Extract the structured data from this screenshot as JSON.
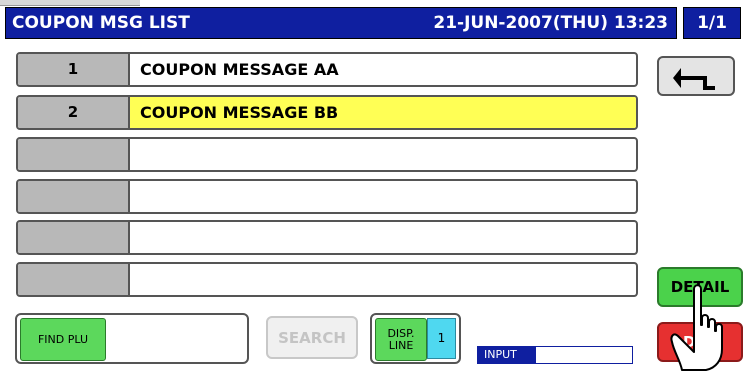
{
  "header": {
    "title": "COUPON MSG LIST",
    "datetime": "21-JUN-2007(THU) 13:23",
    "page": "1/1"
  },
  "rows": [
    {
      "number": "1",
      "message": "COUPON MESSAGE AA"
    },
    {
      "number": "2",
      "message": "COUPON MESSAGE BB"
    },
    {
      "number": "",
      "message": ""
    },
    {
      "number": "",
      "message": ""
    },
    {
      "number": "",
      "message": ""
    },
    {
      "number": "",
      "message": ""
    }
  ],
  "selected_row_index": 1,
  "buttons": {
    "back_icon": "return-arrow-icon",
    "detail": "DETAIL",
    "delete_visible": "DE",
    "find_plu": "FIND PLU",
    "search": "SEARCH",
    "disp_line": "DISP. LINE",
    "disp_line_value": "1"
  },
  "input": {
    "label": "INPUT",
    "value": ""
  },
  "overlays": {
    "pointer": "pointing-hand-icon"
  },
  "colors": {
    "header_blue": "#0f1fa0",
    "selected_yellow": "#ffff55",
    "green_button": "#4bd24b",
    "red_button": "#e63030",
    "cyan_value": "#4fd8f0"
  }
}
